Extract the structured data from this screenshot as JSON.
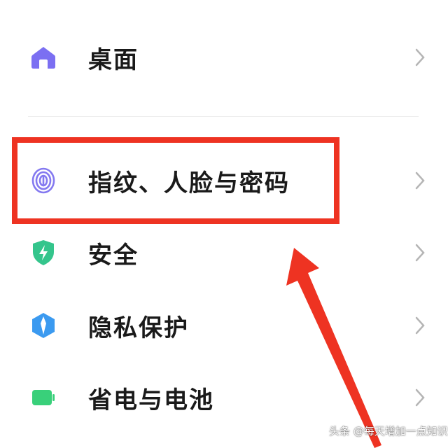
{
  "settings": {
    "items": [
      {
        "label": "桌面",
        "icon": "home-icon",
        "color": "#7b6ff2"
      },
      {
        "label": "指纹、人脸与密码",
        "icon": "fingerprint-icon",
        "color": "#8479f0"
      },
      {
        "label": "安全",
        "icon": "shield-lightning-icon",
        "color": "#34c58c"
      },
      {
        "label": "隐私保护",
        "icon": "privacy-icon",
        "color": "#3b9af0"
      },
      {
        "label": "省电与电池",
        "icon": "battery-icon",
        "color": "#39d07a"
      }
    ]
  },
  "annotation": {
    "highlight_color": "#ee3322"
  },
  "watermark": {
    "text": "头条 @每天增加一点知识"
  }
}
